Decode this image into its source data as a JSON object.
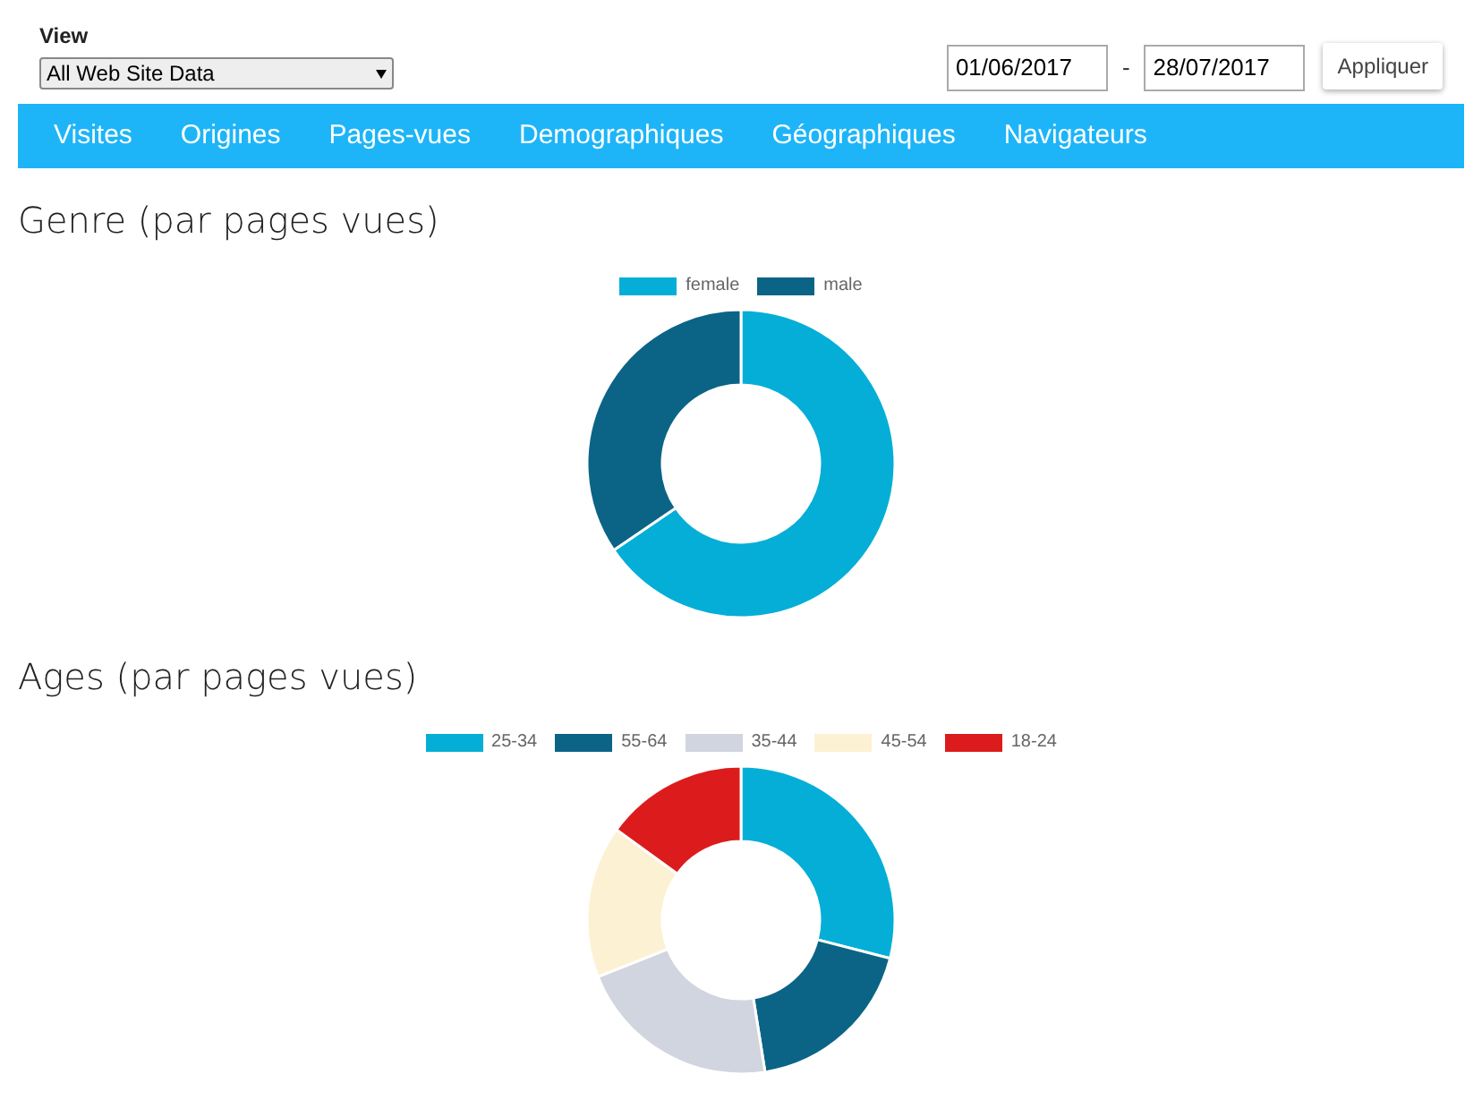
{
  "view": {
    "label": "View",
    "value": "All Web Site Data"
  },
  "date_range": {
    "start": "01/06/2017",
    "separator": "-",
    "end": "28/07/2017",
    "button": "Appliquer"
  },
  "nav": [
    {
      "label": "Visites"
    },
    {
      "label": "Origines"
    },
    {
      "label": "Pages-vues"
    },
    {
      "label": "Demographiques"
    },
    {
      "label": "Géographiques"
    },
    {
      "label": "Navigateurs"
    }
  ],
  "sections": [
    {
      "title": "Genre (par pages vues)",
      "legend": [
        {
          "label": "female",
          "color": "#05aed6"
        },
        {
          "label": "male",
          "color": "#0b6485"
        }
      ]
    },
    {
      "title": "Ages (par pages vues)",
      "legend": [
        {
          "label": "25-34",
          "color": "#05aed6"
        },
        {
          "label": "55-64",
          "color": "#0b6485"
        },
        {
          "label": "35-44",
          "color": "#d1d5df"
        },
        {
          "label": "45-54",
          "color": "#fdf1d3"
        },
        {
          "label": "18-24",
          "color": "#dc1c1c"
        }
      ]
    }
  ]
}
